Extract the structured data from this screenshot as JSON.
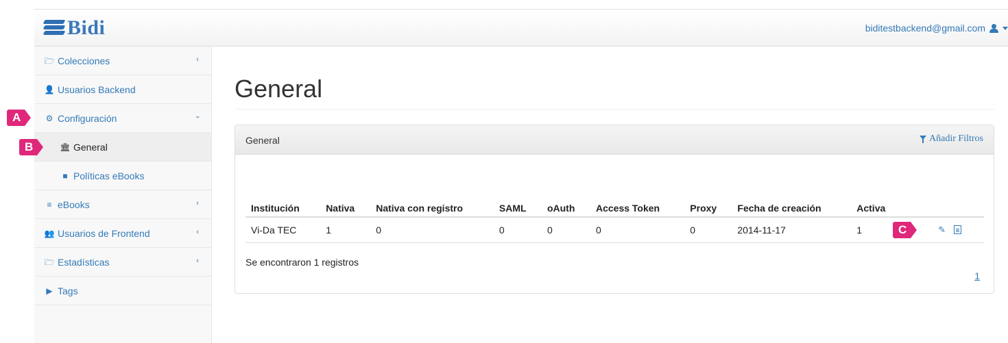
{
  "header": {
    "brand": "Bidi",
    "user_email": "biditestbackend@gmail.com"
  },
  "sidebar": {
    "items": [
      {
        "label": "Colecciones",
        "icon": "folder-open-icon",
        "has_chevron": true
      },
      {
        "label": "Usuarios Backend",
        "icon": "user-icon"
      },
      {
        "label": "Configuración",
        "icon": "gears-icon",
        "expanded": true
      },
      {
        "label": "General",
        "icon": "institution-icon",
        "active": true
      },
      {
        "label": "Políticas eBooks",
        "icon": "file-icon"
      },
      {
        "label": "eBooks",
        "icon": "database-icon",
        "has_chevron": true
      },
      {
        "label": "Usuarios de Frontend",
        "icon": "users-icon",
        "has_chevron": true
      },
      {
        "label": "Estadísticas",
        "icon": "folder-open-icon",
        "has_chevron": true
      },
      {
        "label": "Tags",
        "icon": "tags-icon"
      }
    ]
  },
  "main": {
    "title": "General",
    "panel": {
      "title": "General",
      "filters_label": "Añadir Filtros",
      "columns": [
        "Institución",
        "Nativa",
        "Nativa con registro",
        "SAML",
        "oAuth",
        "Access Token",
        "Proxy",
        "Fecha de creación",
        "Activa"
      ],
      "rows": [
        [
          "Vi-Da TEC",
          "1",
          "0",
          "0",
          "0",
          "0",
          "0",
          "2014-11-17",
          "1"
        ]
      ],
      "records_text": "Se encontraron 1 registros",
      "page": "1"
    }
  },
  "markers": {
    "a": "A",
    "b": "B",
    "c": "C"
  },
  "colors": {
    "accent": "#337ab7",
    "marker": "#e0287a"
  }
}
